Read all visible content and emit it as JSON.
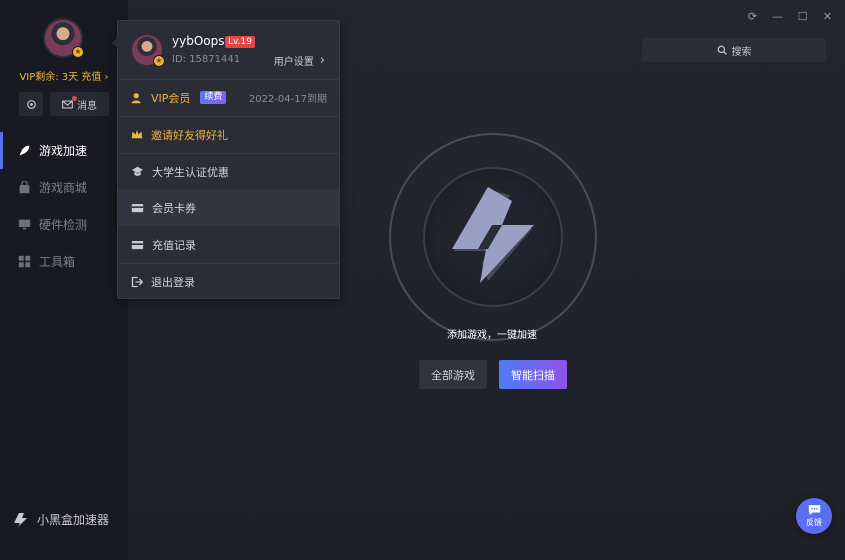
{
  "sidebar": {
    "vip_remaining": "VIP剩余: 3天 充值",
    "message_label": "消息",
    "nav": [
      {
        "label": "游戏加速",
        "icon": "rocket-icon",
        "active": true
      },
      {
        "label": "游戏商城",
        "icon": "shop-icon",
        "active": false
      },
      {
        "label": "硬件检测",
        "icon": "monitor-icon",
        "active": false
      },
      {
        "label": "工具箱",
        "icon": "toolbox-icon",
        "active": false
      }
    ],
    "brand_name": "小黑盒加速器"
  },
  "dropdown": {
    "username": "yybOops",
    "level": "Lv.19",
    "user_id": "ID: 15871441",
    "settings_label": "用户设置",
    "vip_label": "VIP会员",
    "renew_label": "续费",
    "vip_expiry": "2022-04-17到期",
    "items": [
      {
        "label": "邀请好友得好礼",
        "icon": "crown-icon"
      },
      {
        "label": "大学生认证优惠",
        "icon": "graduation-cap-icon"
      },
      {
        "label": "会员卡券",
        "icon": "card-icon"
      },
      {
        "label": "充值记录",
        "icon": "wallet-icon"
      },
      {
        "label": "退出登录",
        "icon": "logout-icon"
      }
    ]
  },
  "main": {
    "search_label": "搜索",
    "tagline": "添加游戏，一键加速",
    "all_games_button": "全部游戏",
    "smart_scan_button": "智能扫描",
    "feedback_label": "反馈"
  },
  "colors": {
    "accent": "#5c6fe6",
    "gold": "#f0b43a",
    "level_badge": "#e04848",
    "scan_gradient_start": "#4f7cf5",
    "scan_gradient_end": "#8e54e9"
  }
}
